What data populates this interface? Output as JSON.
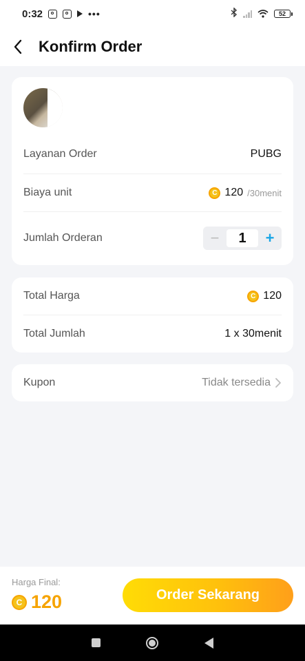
{
  "status_bar": {
    "time": "0:32",
    "battery": "52",
    "dots": "•••"
  },
  "header": {
    "title": "Konfirm Order"
  },
  "order_card": {
    "service_label": "Layanan Order",
    "service_value": "PUBG",
    "unit_cost_label": "Biaya unit",
    "unit_cost_value": "120",
    "unit_cost_suffix": "/30menit",
    "quantity_label": "Jumlah Orderan",
    "quantity_value": "1",
    "minus": "−",
    "plus": "+"
  },
  "summary_card": {
    "total_price_label": "Total Harga",
    "total_price_value": "120",
    "total_amount_label": "Total Jumlah",
    "total_amount_value": "1 x 30menit"
  },
  "coupon_card": {
    "label": "Kupon",
    "value": "Tidak tersedia"
  },
  "bottom_bar": {
    "final_label": "Harga Final:",
    "final_amount": "120",
    "order_button": "Order Sekarang"
  },
  "coin_glyph": "C",
  "colors": {
    "accent": "#f6a300",
    "button_start": "#ffdc06",
    "button_end": "#ff9f1a",
    "plus": "#1aa6e6"
  }
}
